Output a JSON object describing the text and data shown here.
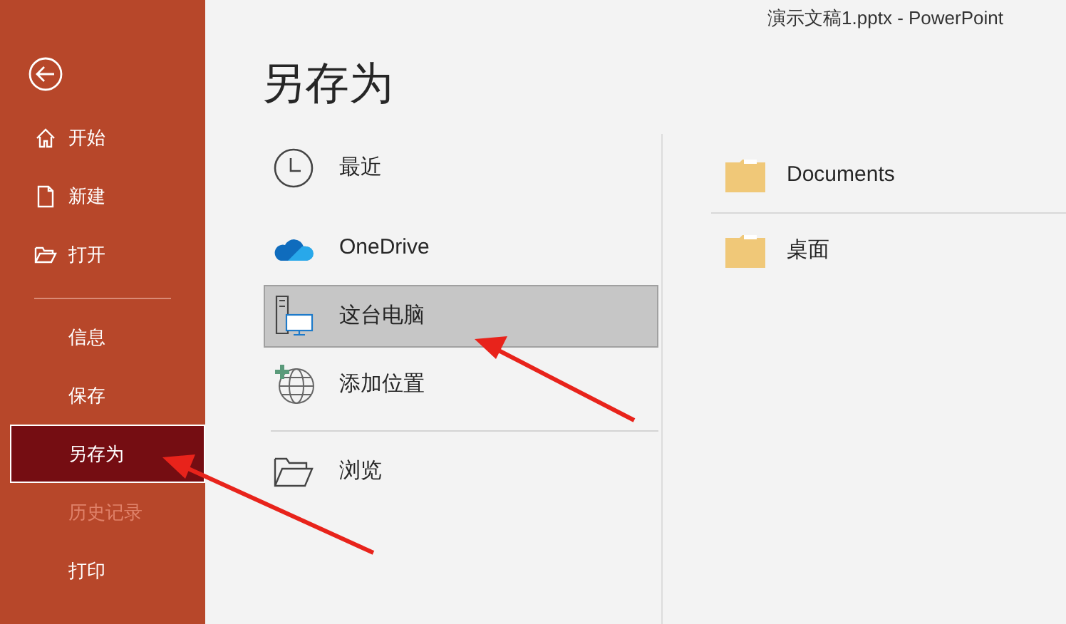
{
  "window": {
    "title": "演示文稿1.pptx  -  PowerPoint"
  },
  "sidebar": {
    "items": [
      {
        "label": "开始",
        "kind": "home",
        "selected": false,
        "disabled": false
      },
      {
        "label": "新建",
        "kind": "new",
        "selected": false,
        "disabled": false
      },
      {
        "label": "打开",
        "kind": "open",
        "selected": false,
        "disabled": false
      },
      {
        "label": "信息",
        "kind": "plain",
        "selected": false,
        "disabled": false
      },
      {
        "label": "保存",
        "kind": "plain",
        "selected": false,
        "disabled": false
      },
      {
        "label": "另存为",
        "kind": "plain",
        "selected": true,
        "disabled": false
      },
      {
        "label": "历史记录",
        "kind": "plain",
        "selected": false,
        "disabled": true
      },
      {
        "label": "打印",
        "kind": "plain",
        "selected": false,
        "disabled": false
      }
    ]
  },
  "heading": "另存为",
  "locations": [
    {
      "label": "最近",
      "kind": "recent",
      "selected": false
    },
    {
      "label": "OneDrive",
      "kind": "onedrive",
      "selected": false
    },
    {
      "label": "这台电脑",
      "kind": "pc",
      "selected": true
    },
    {
      "label": "添加位置",
      "kind": "add",
      "selected": false
    },
    {
      "label": "浏览",
      "kind": "browse",
      "selected": false
    }
  ],
  "folders": [
    {
      "label": "Documents"
    },
    {
      "label": "桌面"
    }
  ]
}
